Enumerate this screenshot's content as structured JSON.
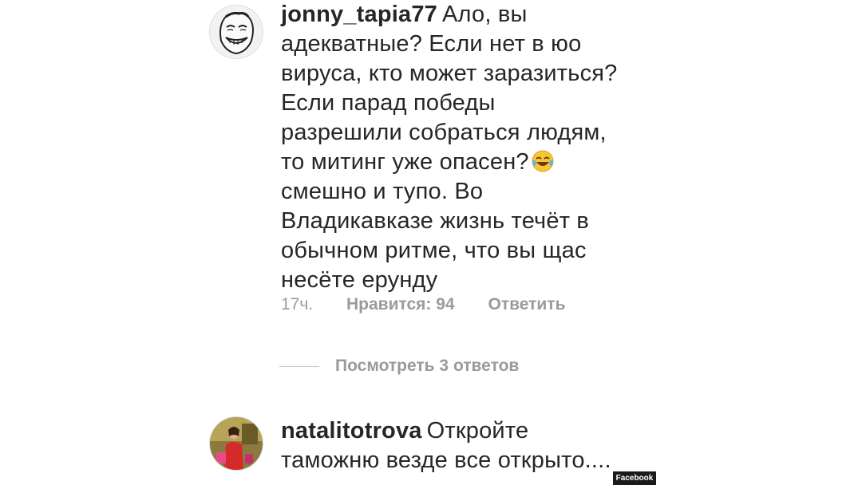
{
  "comments": [
    {
      "username": "jonny_tapia77",
      "lines": [
        "Ало, вы",
        "адекватные? Если нет в юо",
        "вируса, кто может заразиться?",
        "Если парад победы",
        "разрешили собраться людям,",
        "то митинг уже опасен?",
        "смешно и тупо. Во",
        "Владикавказе жизнь течёт в",
        "обычном ритме, что вы щас",
        "несёте ерунду"
      ],
      "time": "17ч.",
      "likes": "Нравится: 94",
      "reply": "Ответить"
    },
    {
      "username": "natalitotrova",
      "lines": [
        "Откройте",
        "таможню везде все открыто...."
      ]
    }
  ],
  "view_replies": "Посмотреть 3 ответов",
  "watermark": "Facebook"
}
